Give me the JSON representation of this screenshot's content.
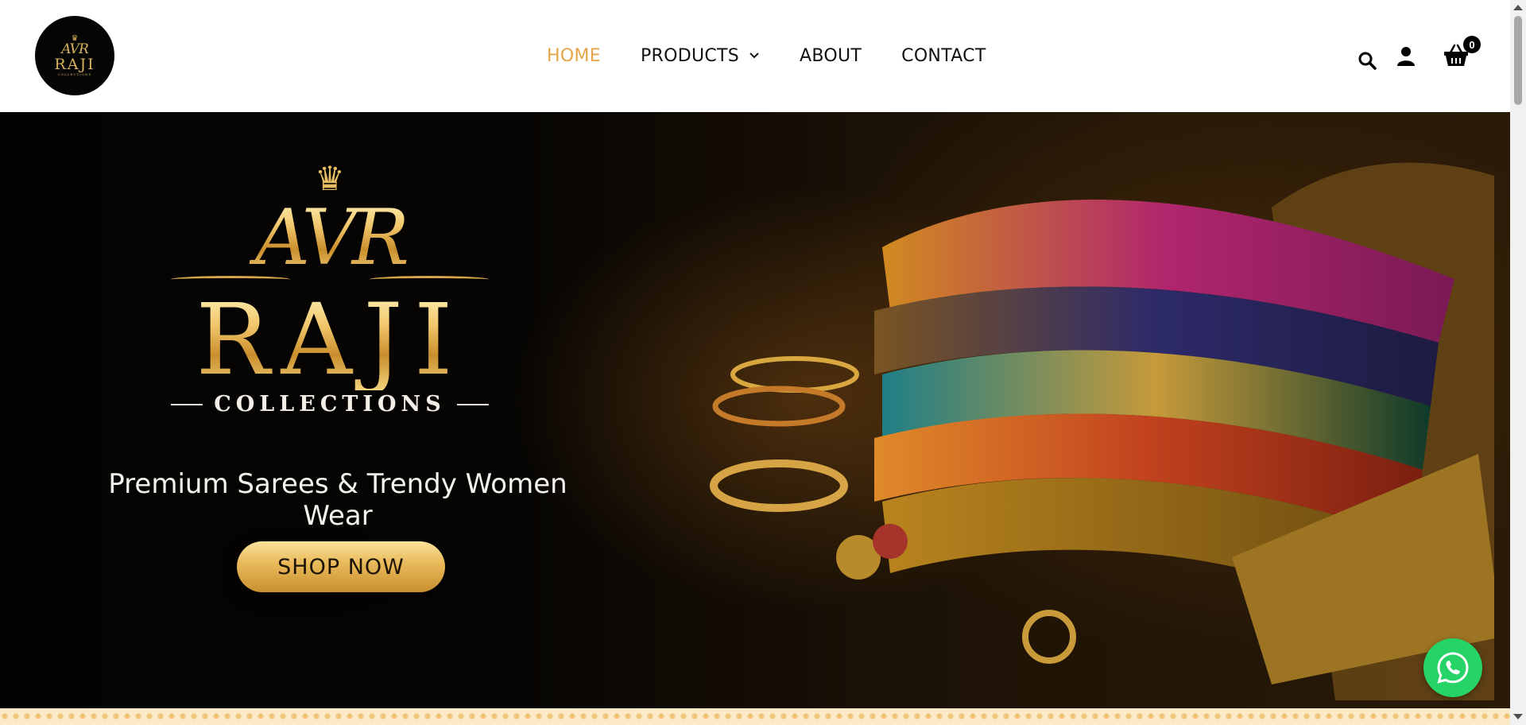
{
  "brand": {
    "logo_crown": "♛",
    "logo_monogram": "AVR",
    "logo_word": "RAJI",
    "logo_sub": "COLLECTIONS"
  },
  "nav": {
    "items": [
      {
        "label": "HOME",
        "active": true
      },
      {
        "label": "PRODUCTS",
        "has_dropdown": true
      },
      {
        "label": "ABOUT"
      },
      {
        "label": "CONTACT"
      }
    ]
  },
  "header_icons": {
    "search": "search-icon",
    "account": "user-icon",
    "cart": "basket-icon",
    "cart_count": "0"
  },
  "hero": {
    "crown": "♛",
    "monogram": "AVR",
    "word": "RAJI",
    "sub": "COLLECTIONS",
    "tagline": "Premium Sarees & Trendy Women Wear",
    "cta_label": "SHOP NOW"
  },
  "floating": {
    "whatsapp": "whatsapp-icon"
  },
  "colors": {
    "accent": "#e4a448",
    "gold": "#d9b25a",
    "whatsapp": "#25d366",
    "text": "#111111"
  }
}
